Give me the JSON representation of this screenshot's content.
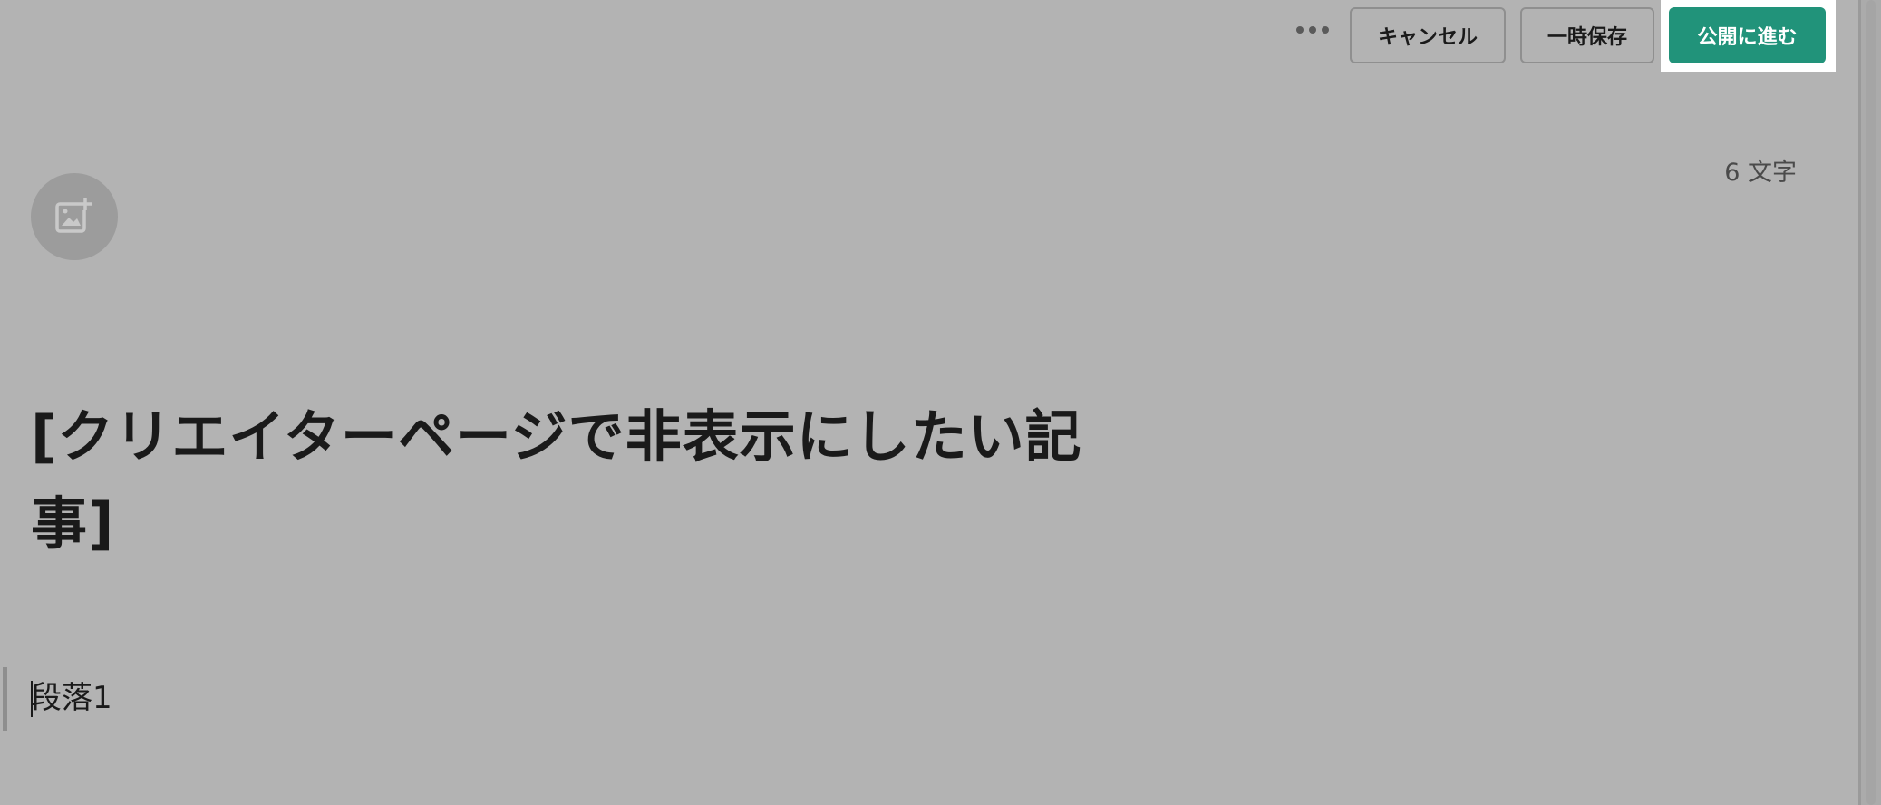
{
  "toolbar": {
    "more_icon": "more-horizontal-icon",
    "cancel_label": "キャンセル",
    "draft_label": "一時保存",
    "publish_label": "公開に進む",
    "publish_color": "#21937a"
  },
  "editor": {
    "char_count": "6 文字",
    "image_add_icon": "image-add-icon",
    "title_line1": "[クリエイターページで非表示にしたい記",
    "title_line2": "事]",
    "paragraph": "段落1"
  }
}
